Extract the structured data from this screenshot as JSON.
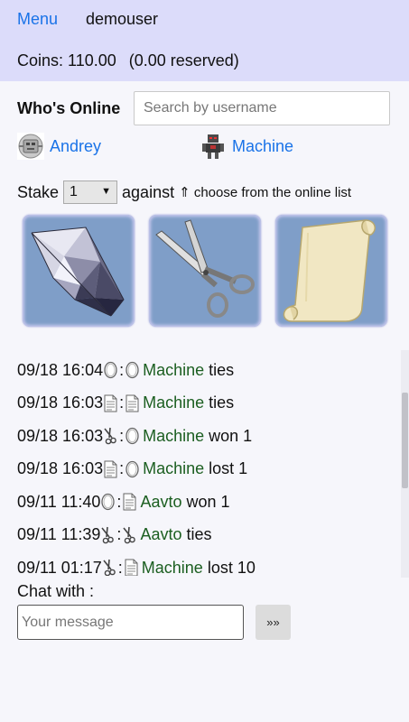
{
  "header": {
    "menu_label": "Menu",
    "username": "demouser",
    "coins_text": "Coins: 110.00",
    "reserved_text": "(0.00 reserved)"
  },
  "online": {
    "title": "Who's Online",
    "search_placeholder": "Search by username",
    "users": [
      {
        "name": "Andrey",
        "avatar": "grey-robot-avatar"
      },
      {
        "name": "Machine",
        "avatar": "dark-robot-avatar"
      }
    ]
  },
  "stake": {
    "label": "Stake",
    "value": "1",
    "against_label": "against",
    "hint": "⇑ choose from the online list"
  },
  "choices": [
    {
      "name": "rock",
      "icon": "diamond-icon"
    },
    {
      "name": "scissors",
      "icon": "scissors-icon"
    },
    {
      "name": "paper",
      "icon": "paper-scroll-icon"
    }
  ],
  "history": [
    {
      "time": "09/18 16:04",
      "mine": "rock",
      "theirs": "rock",
      "opponent": "Machine",
      "result": "ties"
    },
    {
      "time": "09/18 16:03",
      "mine": "paper",
      "theirs": "paper",
      "opponent": "Machine",
      "result": "ties"
    },
    {
      "time": "09/18 16:03",
      "mine": "scissors",
      "theirs": "rock",
      "opponent": "Machine",
      "result": "won 1"
    },
    {
      "time": "09/18 16:03",
      "mine": "paper",
      "theirs": "rock",
      "opponent": "Machine",
      "result": "lost 1"
    },
    {
      "time": "09/11 11:40",
      "mine": "rock",
      "theirs": "paper",
      "opponent": "Aavto",
      "result": "won 1"
    },
    {
      "time": "09/11 11:39",
      "mine": "scissors",
      "theirs": "scissors",
      "opponent": "Aavto",
      "result": "ties"
    },
    {
      "time": "09/11 01:17",
      "mine": "scissors",
      "theirs": "paper",
      "opponent": "Machine",
      "result": "lost 10"
    }
  ],
  "chat": {
    "label": "Chat with :",
    "placeholder": "Your message",
    "send_label": "»»"
  },
  "colors": {
    "header_bg": "#dcdcfa",
    "link": "#1a73e8",
    "opponent": "#1b5e20",
    "tile_bg": "#7f9ec8"
  }
}
